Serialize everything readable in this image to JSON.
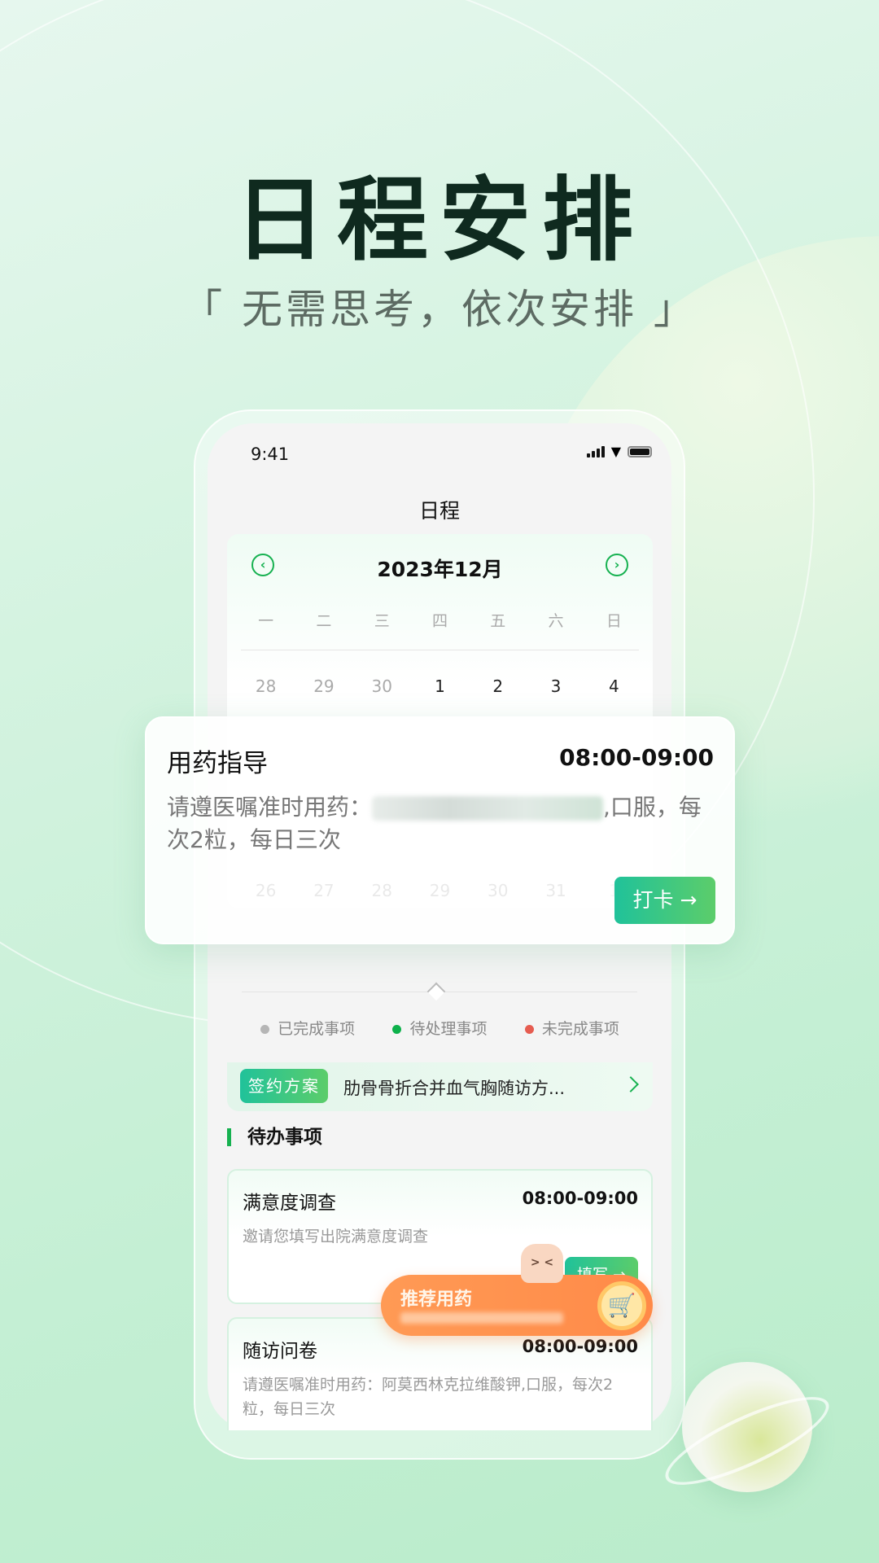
{
  "hero": {
    "title": "日程安排",
    "subtitle": "「 无需思考，依次安排 」"
  },
  "status_bar": {
    "time": "9:41"
  },
  "nav": {
    "title": "日程"
  },
  "calendar": {
    "month": "2023年12月",
    "weekdays": [
      "一",
      "二",
      "三",
      "四",
      "五",
      "六",
      "日"
    ],
    "first_row": [
      "28",
      "29",
      "30",
      "1",
      "2",
      "3",
      "4"
    ],
    "last_row": [
      "26",
      "27",
      "28",
      "29",
      "30",
      "31",
      "1"
    ]
  },
  "floating_card": {
    "title": "用药指导",
    "time": "08:00-09:00",
    "body_prefix": "请遵医嘱准时用药：",
    "body_suffix": ",口服，每次2粒，每日三次",
    "button": "打卡 →"
  },
  "legend": [
    {
      "label": "已完成事项",
      "color": "#b5b5b5"
    },
    {
      "label": "待处理事项",
      "color": "#0db14b"
    },
    {
      "label": "未完成事项",
      "color": "#e65c50"
    }
  ],
  "plan": {
    "tag": "签约方案",
    "text": "肋骨骨折合并血气胸随访方..."
  },
  "todo": {
    "heading": "待办事项",
    "items": [
      {
        "title": "满意度调查",
        "time": "08:00-09:00",
        "body": "邀请您填写出院满意度调查",
        "button": "填写 →"
      },
      {
        "title": "随访问卷",
        "time": "08:00-09:00",
        "body": "请遵医嘱准时用药：阿莫西林克拉维酸钾,口服，每次2粒，每日三次"
      }
    ]
  },
  "recommend": {
    "title": "推荐用药",
    "icon": "cart-icon"
  },
  "colors": {
    "accent": "#16b150",
    "orange": "#ff8a48"
  }
}
